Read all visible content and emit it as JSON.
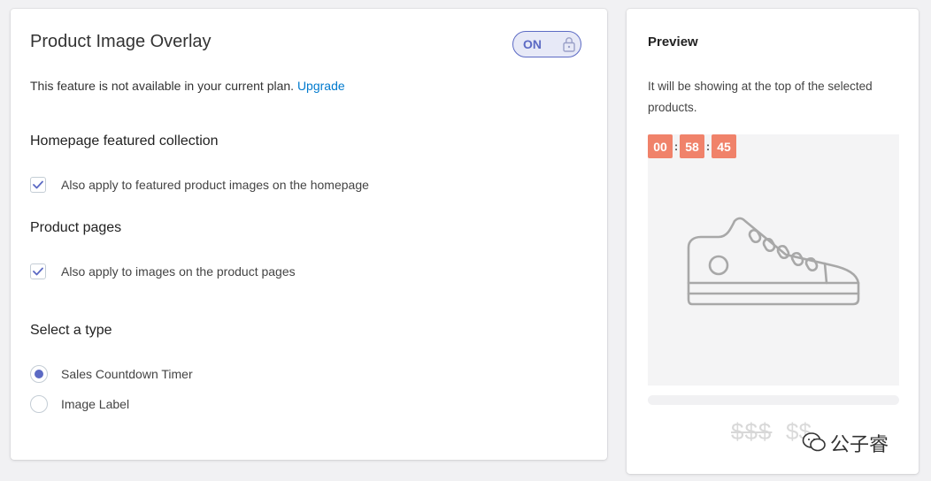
{
  "overlay": {
    "title": "Product Image Overlay",
    "toggle_label": "ON",
    "notice_text": "This feature is not available in your current plan.",
    "upgrade_link": "Upgrade"
  },
  "homepage": {
    "title": "Homepage featured collection",
    "checkbox_label": "Also apply to featured product images on the homepage",
    "checked": true
  },
  "product_pages": {
    "title": "Product pages",
    "checkbox_label": "Also apply to images on the product pages",
    "checked": true
  },
  "type_select": {
    "title": "Select a type",
    "options": [
      {
        "label": "Sales Countdown Timer",
        "selected": true
      },
      {
        "label": "Image Label",
        "selected": false
      }
    ]
  },
  "preview": {
    "title": "Preview",
    "description": "It will be showing at the top of the selected products.",
    "timer": {
      "hours": "00",
      "minutes": "58",
      "seconds": "45",
      "separator": ":"
    },
    "price_text": "$$$",
    "price_text_2": "$$",
    "watermark": "公子睿"
  },
  "colors": {
    "accent": "#5c6ac4",
    "link": "#007ace",
    "timer_bg": "#f0826a"
  },
  "icons": [
    "lock-icon",
    "checkmark-icon",
    "shoe-icon",
    "wechat-icon"
  ]
}
